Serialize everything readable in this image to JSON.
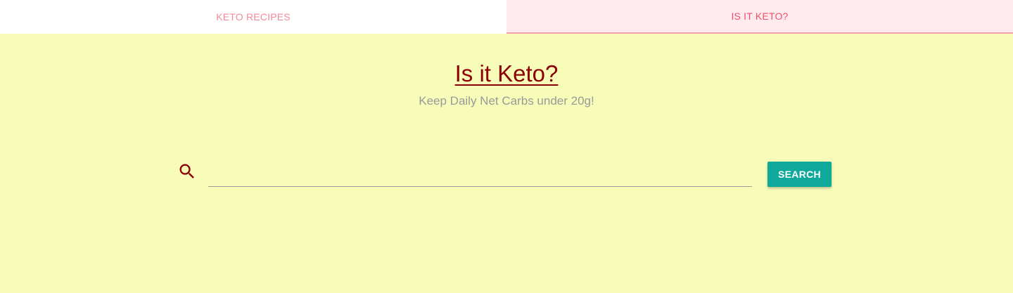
{
  "tabs": [
    {
      "label": "KETO RECIPES",
      "active": false
    },
    {
      "label": "IS IT KETO?",
      "active": true
    }
  ],
  "header": {
    "title": "Is it Keto?",
    "subtitle": "Keep Daily Net Carbs under 20g!"
  },
  "search": {
    "icon": "search-icon",
    "value": "",
    "placeholder": "",
    "button_label": "SEARCH"
  },
  "colors": {
    "background": "#f7fcb9",
    "title": "#8b0000",
    "tab_inactive_text": "#f48a99",
    "tab_active_text": "#e8516a",
    "tab_active_bg": "#ffebee",
    "button_bg": "#0fa99b"
  }
}
